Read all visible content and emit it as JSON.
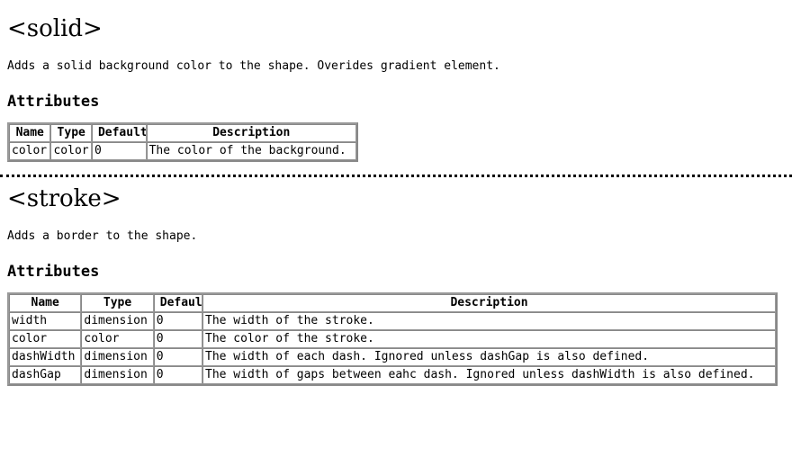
{
  "sections": [
    {
      "title": "<solid>",
      "description": "Adds a solid background color to the shape. Overides gradient element.",
      "attributes_heading": "Attributes",
      "table": {
        "headers": [
          "Name",
          "Type",
          "Default",
          "Description"
        ],
        "rows": [
          [
            "color",
            "color",
            "0",
            "The color of the background."
          ]
        ]
      }
    },
    {
      "title": "<stroke>",
      "description": "Adds a border to the shape.",
      "attributes_heading": "Attributes",
      "table": {
        "headers": [
          "Name",
          "Type",
          "Default",
          "Description"
        ],
        "rows": [
          [
            "width",
            "dimension",
            "0",
            "The width of the stroke."
          ],
          [
            "color",
            "color",
            "0",
            "The color of the stroke."
          ],
          [
            "dashWidth",
            "dimension",
            "0",
            "The width of each dash. Ignored unless dashGap is also defined."
          ],
          [
            "dashGap",
            "dimension",
            "0",
            "The width of gaps between eahc dash. Ignored unless dashWidth is also defined."
          ]
        ]
      }
    }
  ],
  "separator": {
    "style": "dotted",
    "color": "#000000"
  }
}
